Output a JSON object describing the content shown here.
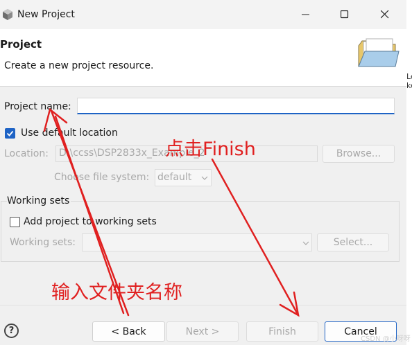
{
  "window": {
    "title": "New Project",
    "icon": "gear-cube-icon",
    "controls": [
      "minimize-icon",
      "maximize-icon",
      "close-icon"
    ]
  },
  "banner": {
    "title": "Project",
    "description": "Create a new project resource.",
    "icon": "folder-icon"
  },
  "edge_text": [
    "Le",
    "ke"
  ],
  "form": {
    "project_name_label": "Project name:",
    "project_name_value": "",
    "use_default_label": "Use default location",
    "use_default_checked": true,
    "location_label": "Location:",
    "location_value": "D:\\ccss\\DSP2833x_Example_2",
    "browse_label": "Browse...",
    "file_system_label": "Choose file system:",
    "file_system_value": "default"
  },
  "working_sets": {
    "group_label": "Working sets",
    "add_label": "Add project to working sets",
    "add_checked": false,
    "sets_label": "Working sets:",
    "sets_value": "",
    "select_label": "Select..."
  },
  "footer": {
    "help_label": "?",
    "back_label": "< Back",
    "next_label": "Next >",
    "finish_label": "Finish",
    "cancel_label": "Cancel"
  },
  "annotations": {
    "finish_note": "点击Finish",
    "name_note": "输入文件夹名称",
    "color": "#e02020"
  },
  "watermark": "CSDN @小呀呀",
  "colors": {
    "accent": "#1e63c5",
    "annotation": "#e02020"
  }
}
